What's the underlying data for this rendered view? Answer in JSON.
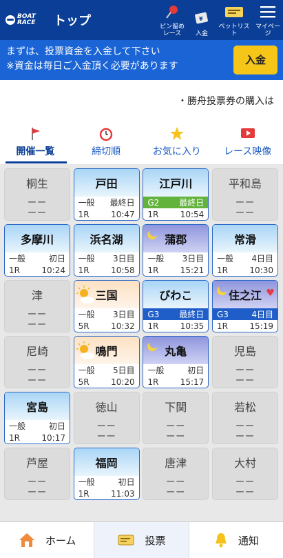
{
  "header": {
    "logo_line1": "BOAT",
    "logo_line2": "RACE",
    "title": "トップ",
    "pin_label_1": "ピン留め",
    "pin_label_2": "レース",
    "deposit_label": "入金",
    "betlist_label": "ベットリスト",
    "mypage_label": "マイページ"
  },
  "notice": {
    "line1": "まずは、投票資金を入金して下さい",
    "line2": "※資金は毎日ご入金頂く必要があります",
    "button": "入金"
  },
  "ticker": "・勝舟投票券の購入は",
  "tabs": [
    {
      "label": "開催一覧",
      "icon": "flag-icon"
    },
    {
      "label": "締切順",
      "icon": "alarm-clock-icon"
    },
    {
      "label": "お気に入り",
      "icon": "star-icon"
    },
    {
      "label": "レース映像",
      "icon": "video-icon"
    }
  ],
  "colors": {
    "header": "#0b3f97",
    "notice": "#1a64d6",
    "deposit": "#f5c518",
    "g2": "#62b33c",
    "g3": "#1f5ec9"
  },
  "venues": [
    {
      "name": "桐生",
      "active": false,
      "dash1": "ーー",
      "dash2": "ーー"
    },
    {
      "name": "戸田",
      "active": true,
      "grade": "一般",
      "day": "最終日",
      "race": "1R",
      "time": "10:47"
    },
    {
      "name": "江戸川",
      "active": true,
      "grade": "G2",
      "day": "最終日",
      "race": "1R",
      "time": "10:54"
    },
    {
      "name": "平和島",
      "active": false,
      "dash1": "ーー",
      "dash2": "ーー"
    },
    {
      "name": "多摩川",
      "active": true,
      "grade": "一般",
      "day": "初日",
      "race": "1R",
      "time": "10:24"
    },
    {
      "name": "浜名湖",
      "active": true,
      "grade": "一般",
      "day": "3日目",
      "race": "1R",
      "time": "10:58"
    },
    {
      "name": "蒲郡",
      "active": true,
      "grade": "一般",
      "day": "3日目",
      "race": "1R",
      "time": "15:21",
      "icon": "moon-icon"
    },
    {
      "name": "常滑",
      "active": true,
      "grade": "一般",
      "day": "4日目",
      "race": "1R",
      "time": "10:30"
    },
    {
      "name": "津",
      "active": false,
      "dash1": "ーー",
      "dash2": "ーー"
    },
    {
      "name": "三国",
      "active": true,
      "grade": "一般",
      "day": "3日目",
      "race": "5R",
      "time": "10:32",
      "icon": "sun-icon"
    },
    {
      "name": "びわこ",
      "active": true,
      "grade": "G3",
      "day": "最終日",
      "race": "1R",
      "time": "10:35"
    },
    {
      "name": "住之江",
      "active": true,
      "grade": "G3",
      "day": "4日目",
      "race": "1R",
      "time": "15:19",
      "icon": "moon-icon",
      "favorite": true
    },
    {
      "name": "尼崎",
      "active": false,
      "dash1": "ーー",
      "dash2": "ーー"
    },
    {
      "name": "鳴門",
      "active": true,
      "grade": "一般",
      "day": "5日目",
      "race": "5R",
      "time": "10:20",
      "icon": "sun-icon"
    },
    {
      "name": "丸亀",
      "active": true,
      "grade": "一般",
      "day": "初日",
      "race": "1R",
      "time": "15:17",
      "icon": "moon-icon"
    },
    {
      "name": "児島",
      "active": false,
      "dash1": "ーー",
      "dash2": "ーー"
    },
    {
      "name": "宮島",
      "active": true,
      "grade": "一般",
      "day": "初日",
      "race": "1R",
      "time": "10:17"
    },
    {
      "name": "徳山",
      "active": false,
      "dash1": "ーー",
      "dash2": "ーー"
    },
    {
      "name": "下関",
      "active": false,
      "dash1": "ーー",
      "dash2": "ーー"
    },
    {
      "name": "若松",
      "active": false,
      "dash1": "ーー",
      "dash2": "ーー"
    },
    {
      "name": "芦屋",
      "active": false,
      "dash1": "ーー",
      "dash2": "ーー"
    },
    {
      "name": "福岡",
      "active": true,
      "grade": "一般",
      "day": "初日",
      "race": "1R",
      "time": "11:03"
    },
    {
      "name": "唐津",
      "active": false,
      "dash1": "ーー",
      "dash2": "ーー"
    },
    {
      "name": "大村",
      "active": false,
      "dash1": "ーー",
      "dash2": "ーー"
    }
  ],
  "bottom_nav": [
    {
      "label": "ホーム",
      "icon": "house-icon"
    },
    {
      "label": "投票",
      "icon": "ticket-icon"
    },
    {
      "label": "通知",
      "icon": "bell-icon"
    }
  ]
}
